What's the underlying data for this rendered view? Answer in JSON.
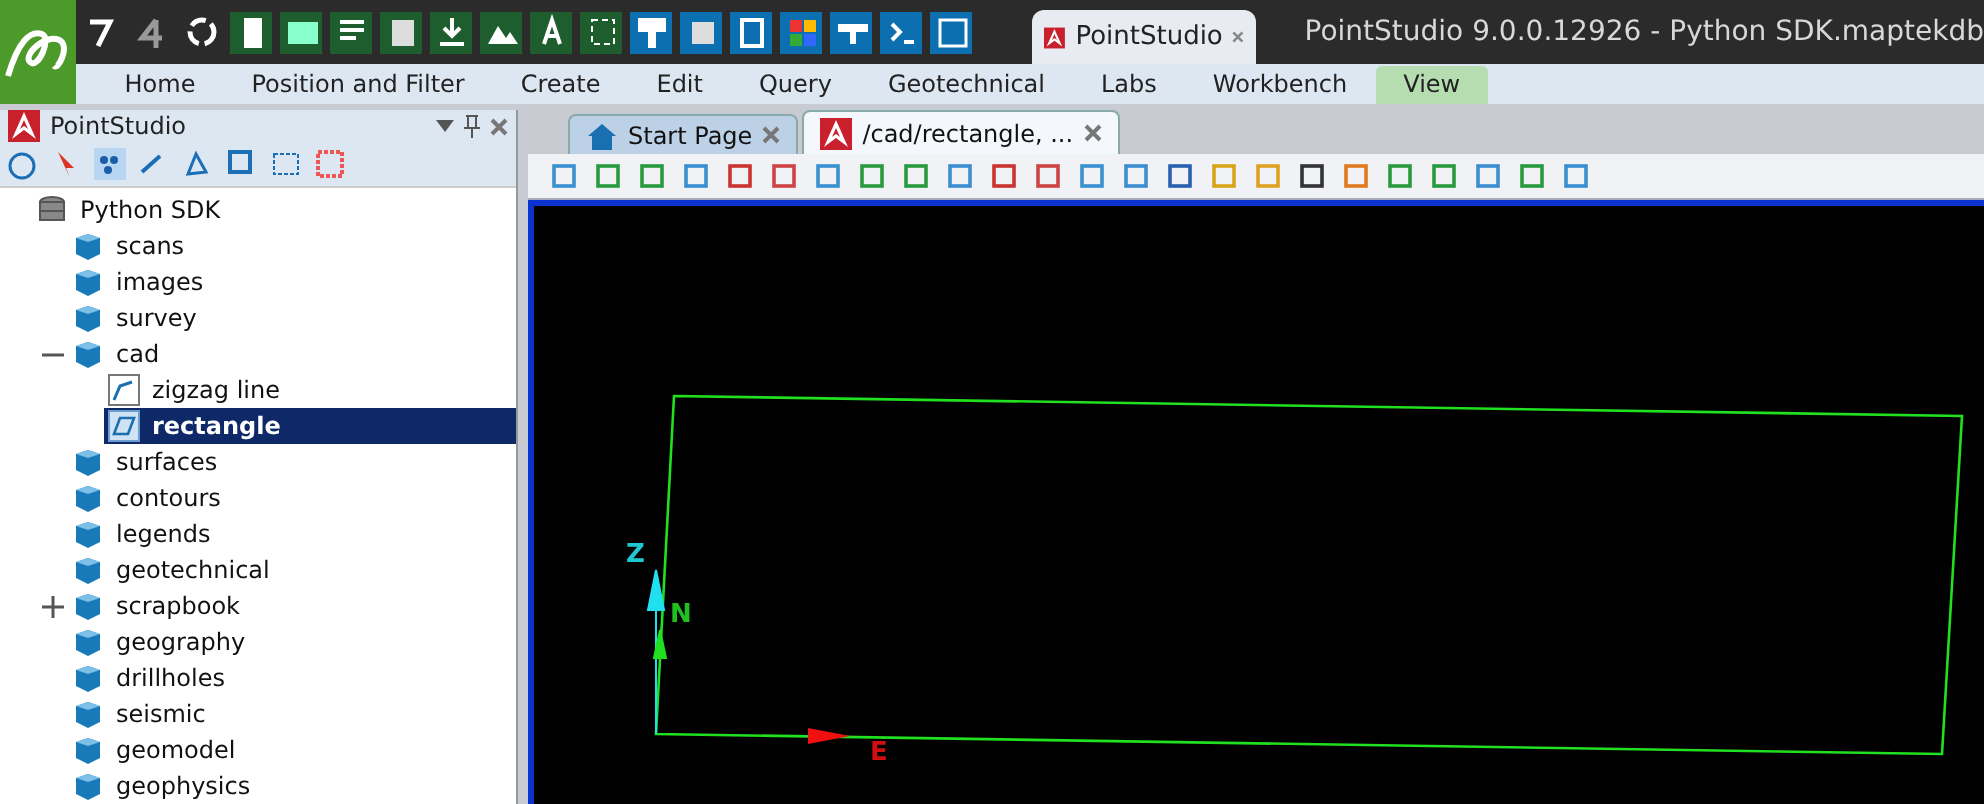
{
  "window": {
    "title": "PointStudio 9.0.0.12926 - Python SDK.maptekdb",
    "app_tab": "PointStudio"
  },
  "menu": [
    {
      "label": "Home",
      "selected": false
    },
    {
      "label": "Position and Filter",
      "selected": false
    },
    {
      "label": "Create",
      "selected": false
    },
    {
      "label": "Edit",
      "selected": false
    },
    {
      "label": "Query",
      "selected": false
    },
    {
      "label": "Geotechnical",
      "selected": false
    },
    {
      "label": "Labs",
      "selected": false
    },
    {
      "label": "Workbench",
      "selected": false
    },
    {
      "label": "View",
      "selected": true
    }
  ],
  "panel": {
    "title": "PointStudio",
    "tree": [
      {
        "label": "Python SDK",
        "kind": "database",
        "selected": false,
        "children": [
          {
            "label": "scans",
            "kind": "container",
            "selected": false
          },
          {
            "label": "images",
            "kind": "container",
            "selected": false
          },
          {
            "label": "survey",
            "kind": "container",
            "selected": false
          },
          {
            "label": "cad",
            "kind": "container",
            "selected": false,
            "expanded": true,
            "children": [
              {
                "label": "zigzag line",
                "kind": "polyline",
                "selected": false
              },
              {
                "label": "rectangle",
                "kind": "polygon",
                "selected": true
              }
            ]
          },
          {
            "label": "surfaces",
            "kind": "container",
            "selected": false
          },
          {
            "label": "contours",
            "kind": "container",
            "selected": false
          },
          {
            "label": "legends",
            "kind": "container",
            "selected": false
          },
          {
            "label": "geotechnical",
            "kind": "container",
            "selected": false
          },
          {
            "label": "scrapbook",
            "kind": "container",
            "selected": false,
            "expanded": false
          },
          {
            "label": "geography",
            "kind": "container",
            "selected": false
          },
          {
            "label": "drillholes",
            "kind": "container",
            "selected": false
          },
          {
            "label": "seismic",
            "kind": "container",
            "selected": false
          },
          {
            "label": "geomodel",
            "kind": "container",
            "selected": false
          },
          {
            "label": "geophysics",
            "kind": "container",
            "selected": false
          }
        ]
      }
    ]
  },
  "document_tabs": [
    {
      "label": "Start Page",
      "kind": "home",
      "selected": false
    },
    {
      "label": "/cad/rectangle, ...",
      "kind": "view",
      "selected": true
    }
  ],
  "viewport": {
    "axes": [
      {
        "label": "Z",
        "kind": "z"
      },
      {
        "label": "N",
        "kind": "n"
      },
      {
        "label": "E",
        "kind": "e"
      }
    ]
  }
}
